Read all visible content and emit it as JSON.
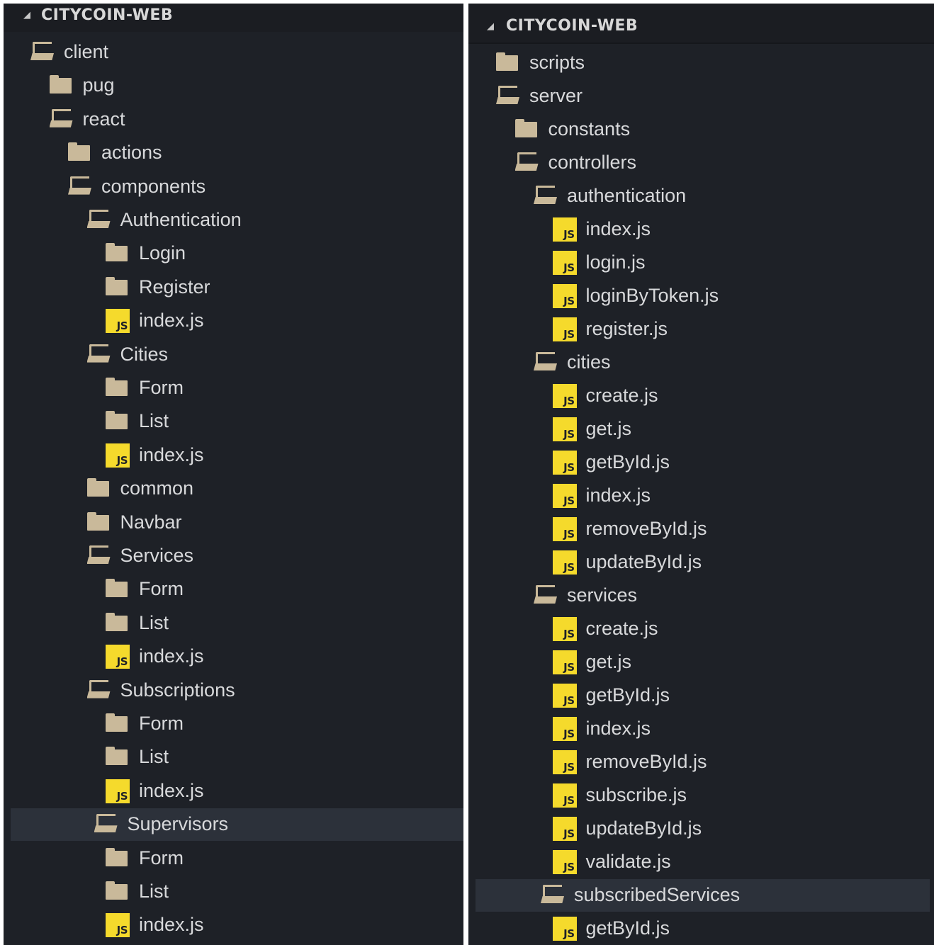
{
  "left": {
    "header": {
      "arrow": "◢",
      "title": "CITYCOIN-WEB"
    },
    "rows": [
      {
        "label": "client",
        "type": "folder-open",
        "depth": 0
      },
      {
        "label": "pug",
        "type": "folder",
        "depth": 1
      },
      {
        "label": "react",
        "type": "folder-open",
        "depth": 1
      },
      {
        "label": "actions",
        "type": "folder",
        "depth": 2
      },
      {
        "label": "components",
        "type": "folder-open",
        "depth": 2
      },
      {
        "label": "Authentication",
        "type": "folder-open",
        "depth": 3
      },
      {
        "label": "Login",
        "type": "folder",
        "depth": 4
      },
      {
        "label": "Register",
        "type": "folder",
        "depth": 4
      },
      {
        "label": "index.js",
        "type": "js",
        "depth": 4
      },
      {
        "label": "Cities",
        "type": "folder-open",
        "depth": 3
      },
      {
        "label": "Form",
        "type": "folder",
        "depth": 4
      },
      {
        "label": "List",
        "type": "folder",
        "depth": 4
      },
      {
        "label": "index.js",
        "type": "js",
        "depth": 4
      },
      {
        "label": "common",
        "type": "folder",
        "depth": 3
      },
      {
        "label": "Navbar",
        "type": "folder",
        "depth": 3
      },
      {
        "label": "Services",
        "type": "folder-open",
        "depth": 3
      },
      {
        "label": "Form",
        "type": "folder",
        "depth": 4
      },
      {
        "label": "List",
        "type": "folder",
        "depth": 4
      },
      {
        "label": "index.js",
        "type": "js",
        "depth": 4
      },
      {
        "label": "Subscriptions",
        "type": "folder-open",
        "depth": 3
      },
      {
        "label": "Form",
        "type": "folder",
        "depth": 4
      },
      {
        "label": "List",
        "type": "folder",
        "depth": 4
      },
      {
        "label": "index.js",
        "type": "js",
        "depth": 4
      },
      {
        "label": "Supervisors",
        "type": "folder-open",
        "depth": 3,
        "selected": true
      },
      {
        "label": "Form",
        "type": "folder",
        "depth": 4
      },
      {
        "label": "List",
        "type": "folder",
        "depth": 4
      },
      {
        "label": "index.js",
        "type": "js",
        "depth": 4
      }
    ]
  },
  "right": {
    "header": {
      "arrow": "◢",
      "title": "CITYCOIN-WEB"
    },
    "rows": [
      {
        "label": "scripts",
        "type": "folder",
        "depth": 0
      },
      {
        "label": "server",
        "type": "folder-open",
        "depth": 0
      },
      {
        "label": "constants",
        "type": "folder",
        "depth": 1
      },
      {
        "label": "controllers",
        "type": "folder-open",
        "depth": 1
      },
      {
        "label": "authentication",
        "type": "folder-open",
        "depth": 2
      },
      {
        "label": "index.js",
        "type": "js",
        "depth": 3
      },
      {
        "label": "login.js",
        "type": "js",
        "depth": 3
      },
      {
        "label": "loginByToken.js",
        "type": "js",
        "depth": 3
      },
      {
        "label": "register.js",
        "type": "js",
        "depth": 3
      },
      {
        "label": "cities",
        "type": "folder-open",
        "depth": 2
      },
      {
        "label": "create.js",
        "type": "js",
        "depth": 3
      },
      {
        "label": "get.js",
        "type": "js",
        "depth": 3
      },
      {
        "label": "getById.js",
        "type": "js",
        "depth": 3
      },
      {
        "label": "index.js",
        "type": "js",
        "depth": 3
      },
      {
        "label": "removeById.js",
        "type": "js",
        "depth": 3
      },
      {
        "label": "updateById.js",
        "type": "js",
        "depth": 3
      },
      {
        "label": "services",
        "type": "folder-open",
        "depth": 2
      },
      {
        "label": "create.js",
        "type": "js",
        "depth": 3
      },
      {
        "label": "get.js",
        "type": "js",
        "depth": 3
      },
      {
        "label": "getById.js",
        "type": "js",
        "depth": 3
      },
      {
        "label": "index.js",
        "type": "js",
        "depth": 3
      },
      {
        "label": "removeById.js",
        "type": "js",
        "depth": 3
      },
      {
        "label": "subscribe.js",
        "type": "js",
        "depth": 3
      },
      {
        "label": "updateById.js",
        "type": "js",
        "depth": 3
      },
      {
        "label": "validate.js",
        "type": "js",
        "depth": 3
      },
      {
        "label": "subscribedServices",
        "type": "folder-open",
        "depth": 2,
        "selected": true
      },
      {
        "label": "getById.js",
        "type": "js",
        "depth": 3
      }
    ]
  },
  "js_badge_text": "JS",
  "colors": {
    "background": "#1e2127",
    "header": "#1b1d22",
    "text": "#d8d9db",
    "folder": "#c9b99a",
    "js_badge": "#f5da2c",
    "selected_row": "#2c313a"
  }
}
